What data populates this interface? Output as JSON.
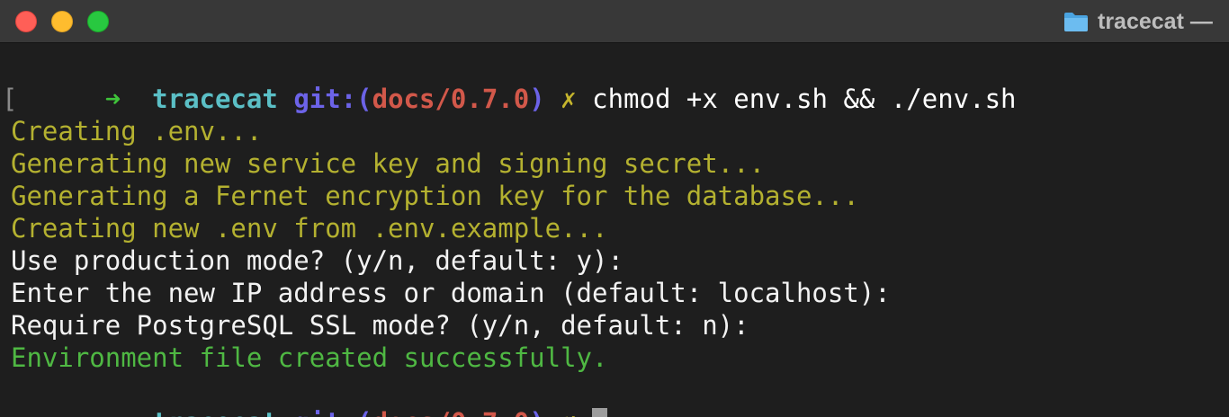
{
  "window": {
    "title": "tracecat — "
  },
  "prompt": {
    "arrow": "➜",
    "directory": "tracecat",
    "git_label": "git:(",
    "branch": "docs/0.7.0",
    "git_close": ")",
    "dirty_marker": "✗"
  },
  "command": "chmod +x env.sh && ./env.sh",
  "output": [
    {
      "text": "Creating .env...",
      "style": "yellow"
    },
    {
      "text": "Generating new service key and signing secret...",
      "style": "yellow"
    },
    {
      "text": "Generating a Fernet encryption key for the database...",
      "style": "yellow"
    },
    {
      "text": "Creating new .env from .env.example...",
      "style": "yellow"
    },
    {
      "text": "Use production mode? (y/n, default: y):",
      "style": "white"
    },
    {
      "text": "Enter the new IP address or domain (default: localhost):",
      "style": "white"
    },
    {
      "text": "Require PostgreSQL SSL mode? (y/n, default: n):",
      "style": "white"
    },
    {
      "text": "Environment file created successfully.",
      "style": "green"
    }
  ],
  "colors": {
    "background": "#1e1e1e",
    "arrow": "#3fc43a",
    "directory": "#5bbfc6",
    "git_label": "#6c63e8",
    "branch": "#d2584a",
    "dirty_marker": "#c5b52d",
    "yellow_output": "#b4b130",
    "white_output": "#f2f2f2",
    "green_output": "#4fb843"
  },
  "icons": {
    "title_icon": "folder-icon"
  }
}
